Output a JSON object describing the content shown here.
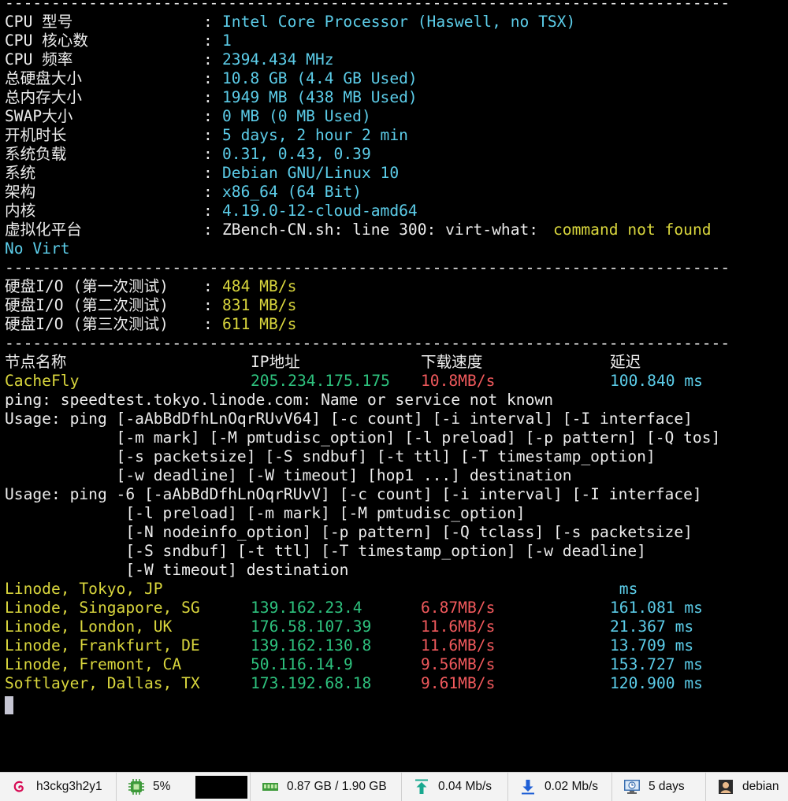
{
  "terminal": {
    "separator": "------------------------------------------------------------------------------",
    "sysinfo": [
      {
        "label": "CPU 型号",
        "sep": ": ",
        "value": "Intel Core Processor (Haswell, no TSX)"
      },
      {
        "label": "CPU 核心数",
        "sep": ": ",
        "value": "1"
      },
      {
        "label": "CPU 频率",
        "sep": ": ",
        "value": "2394.434 MHz"
      },
      {
        "label": "总硬盘大小",
        "sep": ": ",
        "value": "10.8 GB (4.4 GB Used)"
      },
      {
        "label": "总内存大小",
        "sep": ": ",
        "value": "1949 MB (438 MB Used)"
      },
      {
        "label": "SWAP大小",
        "sep": ": ",
        "value": "0 MB (0 MB Used)"
      },
      {
        "label": "开机时长",
        "sep": ": ",
        "value": "5 days, 2 hour 2 min"
      },
      {
        "label": "系统负载",
        "sep": ": ",
        "value": "0.31, 0.43, 0.39"
      },
      {
        "label": "系统",
        "sep": ": ",
        "value": "Debian GNU/Linux 10"
      },
      {
        "label": "架构",
        "sep": ": ",
        "value": "x86_64 (64 Bit)"
      },
      {
        "label": "内核",
        "sep": ": ",
        "value": "4.19.0-12-cloud-amd64"
      }
    ],
    "virt": {
      "label": "虚拟化平台",
      "sep": ": ",
      "error_prefix": "ZBench-CN.sh: line 300: virt-what: ",
      "error_msg": "command not found",
      "result": "No Virt"
    },
    "disk_io": [
      {
        "label": "硬盘I/O (第一次测试)",
        "sep": ": ",
        "value": "484 MB/s"
      },
      {
        "label": "硬盘I/O (第二次测试)",
        "sep": ": ",
        "value": "831 MB/s"
      },
      {
        "label": "硬盘I/O (第三次测试)",
        "sep": ": ",
        "value": "611 MB/s"
      }
    ],
    "speed_header": {
      "node": "节点名称",
      "ip": "IP地址",
      "speed": "下载速度",
      "latency": "延迟"
    },
    "cachefly": {
      "node": "CacheFly",
      "ip": "205.234.175.175",
      "speed": "10.8MB/s",
      "latency": "100.840 ms"
    },
    "ping_output": [
      "ping: speedtest.tokyo.linode.com: Name or service not known",
      "Usage: ping [-aAbBdDfhLnOqrRUvV64] [-c count] [-i interval] [-I interface]",
      "            [-m mark] [-M pmtudisc_option] [-l preload] [-p pattern] [-Q tos]",
      "            [-s packetsize] [-S sndbuf] [-t ttl] [-T timestamp_option]",
      "            [-w deadline] [-W timeout] [hop1 ...] destination",
      "Usage: ping -6 [-aAbBdDfhLnOqrRUvV] [-c count] [-i interval] [-I interface]",
      "             [-l preload] [-m mark] [-M pmtudisc_option]",
      "             [-N nodeinfo_option] [-p pattern] [-Q tclass] [-s packetsize]",
      "             [-S sndbuf] [-t ttl] [-T timestamp_option] [-w deadline]",
      "             [-W timeout] destination"
    ],
    "speed_rows": [
      {
        "node": "Linode, Tokyo, JP",
        "ip": "",
        "speed": "",
        "latency": " ms"
      },
      {
        "node": "Linode, Singapore, SG",
        "ip": "139.162.23.4",
        "speed": "6.87MB/s",
        "latency": "161.081 ms"
      },
      {
        "node": "Linode, London, UK",
        "ip": "176.58.107.39",
        "speed": "11.6MB/s",
        "latency": "21.367 ms"
      },
      {
        "node": "Linode, Frankfurt, DE",
        "ip": "139.162.130.8",
        "speed": "11.6MB/s",
        "latency": "13.709 ms"
      },
      {
        "node": "Linode, Fremont, CA",
        "ip": "50.116.14.9",
        "speed": "9.56MB/s",
        "latency": "153.727 ms"
      },
      {
        "node": "Softlayer, Dallas, TX",
        "ip": "173.192.68.18",
        "speed": "9.61MB/s",
        "latency": "120.900 ms"
      }
    ]
  },
  "statusbar": {
    "hostname": "h3ckg3h2y1",
    "cpu_usage": "5%",
    "memory": "0.87 GB / 1.90 GB",
    "upload": "0.04 Mb/s",
    "download": "0.02 Mb/s",
    "uptime": "5 days",
    "user": "debian",
    "icons": {
      "host": "debian-swirl-icon",
      "cpu": "cpu-chip-icon",
      "memory": "memory-module-icon",
      "upload": "upload-arrow-icon",
      "download": "download-arrow-icon",
      "uptime": "monitor-clock-icon",
      "user": "user-avatar-icon"
    }
  }
}
